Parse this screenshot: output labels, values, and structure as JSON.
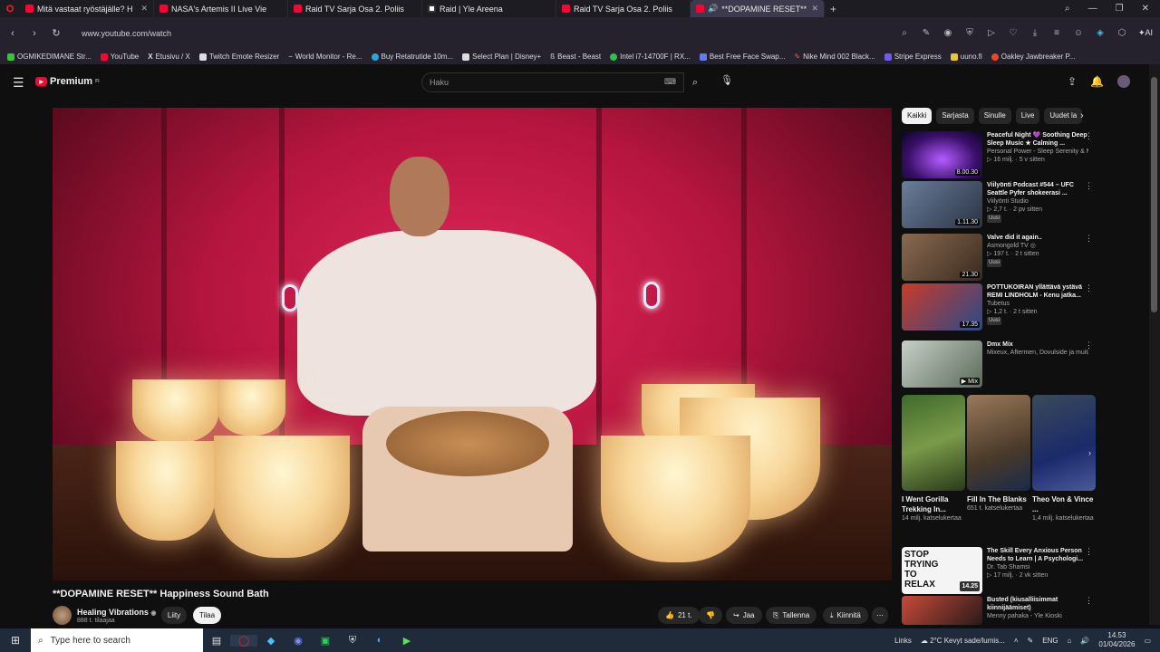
{
  "browser": {
    "tabs": [
      {
        "title": "Mitä vastaat ryöstäjälle? H",
        "favicon": "youtube",
        "active": false
      },
      {
        "title": "NASA's Artemis II Live Vie",
        "favicon": "youtube",
        "active": false
      },
      {
        "title": "Raid TV Sarja Osa 2. Poliis",
        "favicon": "youtube",
        "active": false
      },
      {
        "title": "Raid | Yle Areena",
        "favicon": "yle",
        "active": false
      },
      {
        "title": "Raid TV Sarja Osa 2. Poliis",
        "favicon": "youtube",
        "active": false
      },
      {
        "title": "**DOPAMINE RESET**",
        "favicon": "youtube",
        "active": true
      }
    ],
    "new_tab": "+",
    "url": "www.youtube.com/watch",
    "bookmarks": [
      "OGMIKEDIMANE Str...",
      "YouTube",
      "Etusivu / X",
      "Twitch Emote Resizer",
      "World Monitor - Re...",
      "Buy Retatrutide 10m...",
      "Select Plan | Disney+",
      "Beast - Beast",
      "Intel i7-14700F | RX...",
      "Best Free Face Swap...",
      "Nike Mind 002 Black...",
      "Stripe Express",
      "uuno.fi",
      "Oakley Jawbreaker P..."
    ],
    "ai_label": "AI"
  },
  "header": {
    "logo": "Premium",
    "logo_sup": "FI",
    "search_placeholder": "Haku"
  },
  "video": {
    "title": "**DOPAMINE RESET** Happiness Sound Bath",
    "channel": "Healing Vibrations",
    "subscribers": "888 t. tilaajaa",
    "join": "Liity",
    "subscribe": "Tilaa",
    "likes": "21 t.",
    "share": "Jaa",
    "save": "Tallenna",
    "download": "Kiinnitä"
  },
  "sidebar": {
    "chips": [
      "Kaikki",
      "Sarjasta",
      "Sinulle",
      "Live",
      "Uudet la"
    ],
    "recommendations": [
      {
        "title": "Peaceful Night 💜 Soothing Deep Sleep Music ★ Calming ...",
        "channel": "Personal Power - Sleep Serenity & Meditat",
        "meta": "▷ 16 milj. · 5 v sitten",
        "duration": "8.00.30",
        "badge": ""
      },
      {
        "title": "Viilyönti Podcast #544 – UFC Seattle Pyfer shokeerasi ...",
        "channel": "Viilyönti Studio",
        "meta": "▷ 2,7 t. · 2 pv sitten",
        "duration": "1.11.30",
        "badge": "Uusi"
      },
      {
        "title": "Valve did it again..",
        "channel": "Asmongold TV ◎",
        "meta": "▷ 197 t. · 2 t sitten",
        "duration": "21.30",
        "badge": "Uusi"
      },
      {
        "title": "POTTUKOIRAN yllättävä ystävä REMI LINDHOLM - Kenu jatka...",
        "channel": "Tubetus",
        "meta": "▷ 1,2 t. · 2 t sitten",
        "duration": "17.35",
        "badge": "Uusi"
      },
      {
        "title": "Dmx Mix",
        "channel": "Mixeux, Aftermen, Dovulside ja muita",
        "meta": "",
        "duration": "Mix",
        "badge": ""
      }
    ],
    "shorts": [
      {
        "title": "I Went Gorilla Trekking In...",
        "views": "14 milj. katselukertaa"
      },
      {
        "title": "Fill In The Blanks",
        "views": "651 t. katselukertaa"
      },
      {
        "title": "Theo Von & Vince ...",
        "views": "1,4 milj. katselukertaa"
      }
    ],
    "more_recs": [
      {
        "title": "The Skill Every Anxious Person Needs to Learn | A Psychologi...",
        "channel": "Dr. Tab Shamsi",
        "meta": "▷ 17 milj. · 2 vk sitten",
        "duration": "14.25",
        "thumb_text": "STOP TRYING TO RELAX"
      },
      {
        "title": "Busted (kiusalliisimmat kiinnijäämiset)",
        "channel": "Menny pahaka - Yle Kioski",
        "meta": "",
        "duration": "",
        "thumb_text": ""
      }
    ]
  },
  "taskbar": {
    "search_placeholder": "Type here to search",
    "links": "Links",
    "weather": "2°C  Kevyt sade/lumis...",
    "lang": "ENG",
    "time": "14.53",
    "date": "01/04/2026"
  }
}
